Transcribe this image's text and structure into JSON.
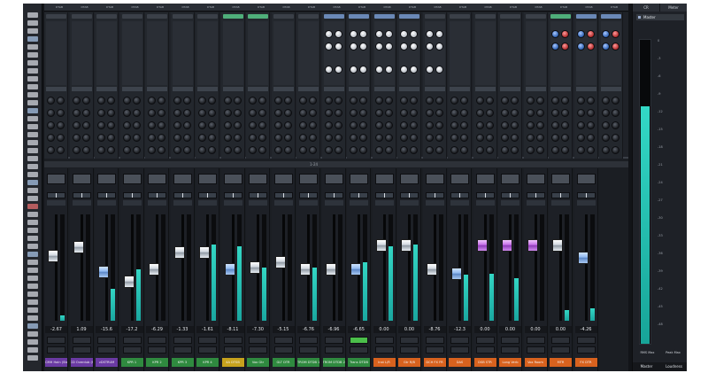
{
  "app": {
    "title": "MIXER"
  },
  "colors": {
    "accent_teal": "#33d6c4",
    "mute_green": "#4bbf4a",
    "strip_bg": "#1d2026",
    "bg": "#121418"
  },
  "top_channel_names": [
    "DTAB",
    "DTAB",
    "DTAB",
    "DTAB",
    "DTAB",
    "DTAB",
    "DTAB",
    "DTAB",
    "DTAB",
    "DTAB",
    "DTAB",
    "DTAB",
    "DTAB",
    "DTAB",
    "DTAB",
    "DTAB",
    "DTAB",
    "DTAB",
    "DTAB",
    "DTAB",
    "DTAB",
    "DTAB",
    "DTAB"
  ],
  "overview_label": "1-24",
  "channels": [
    {
      "value": "-2.67",
      "fader_level": 0.62,
      "meter_level": 0.05,
      "fader_style": "w",
      "name": "CMH Hain (Stereo 1)",
      "name_color": "#6a3aa3",
      "mute_on": false
    },
    {
      "value": "1.09",
      "fader_level": 0.72,
      "meter_level": 0.0,
      "fader_style": "w",
      "name": "CD Overdub (Stereo)",
      "name_color": "#6a3aa3",
      "mute_on": false
    },
    {
      "value": "-15.6",
      "fader_level": 0.45,
      "meter_level": 0.3,
      "fader_style": "b",
      "name": "vDSTRUM",
      "name_color": "#6a3aa3",
      "mute_on": false
    },
    {
      "value": "-17.2",
      "fader_level": 0.35,
      "meter_level": 0.48,
      "fader_style": "w",
      "name": "KPR 1",
      "name_color": "#2f8a3f",
      "mute_on": false
    },
    {
      "value": "-6.29",
      "fader_level": 0.48,
      "meter_level": 0.0,
      "fader_style": "w",
      "name": "KPR 2",
      "name_color": "#2f8a3f",
      "mute_on": false
    },
    {
      "value": "-1.33",
      "fader_level": 0.66,
      "meter_level": 0.0,
      "fader_style": "w",
      "name": "KPR 3",
      "name_color": "#2f8a3f",
      "mute_on": false
    },
    {
      "value": "-1.61",
      "fader_level": 0.66,
      "meter_level": 0.72,
      "fader_style": "w",
      "name": "KPR 4",
      "name_color": "#2f8a3f",
      "mute_on": false
    },
    {
      "value": "-8.11",
      "fader_level": 0.48,
      "meter_level": 0.7,
      "fader_style": "b",
      "name": "4A DTSB",
      "name_color": "#c7a21d",
      "mute_on": false
    },
    {
      "value": "-7.30",
      "fader_level": 0.5,
      "meter_level": 0.5,
      "fader_style": "w",
      "name": "Vox Gtr",
      "name_color": "#2f8a3f",
      "mute_on": false
    },
    {
      "value": "-5.15",
      "fader_level": 0.56,
      "meter_level": 0.0,
      "fader_style": "w",
      "name": "GLT DTR",
      "name_color": "#2f8a3f",
      "mute_on": false
    },
    {
      "value": "-6.76",
      "fader_level": 0.48,
      "meter_level": 0.5,
      "fader_style": "w",
      "name": "TROM DTDB 1",
      "name_color": "#2f8a3f",
      "mute_on": false
    },
    {
      "value": "-6.96",
      "fader_level": 0.48,
      "meter_level": 0.0,
      "fader_style": "w",
      "name": "TROM DTDB 2",
      "name_color": "#2f8a3f",
      "mute_on": false
    },
    {
      "value": "-6.65",
      "fader_level": 0.48,
      "meter_level": 0.55,
      "fader_style": "b",
      "name": "Trans DTDB",
      "name_color": "#2f8a3f",
      "mute_on": true
    },
    {
      "value": "0.00",
      "fader_level": 0.74,
      "meter_level": 0.7,
      "fader_style": "w",
      "name": "Inst L/R",
      "name_color": "#d8621e",
      "mute_on": false
    },
    {
      "value": "0.00",
      "fader_level": 0.74,
      "meter_level": 0.72,
      "fader_style": "w",
      "name": "Gtr R/B",
      "name_color": "#d8621e",
      "mute_on": false
    },
    {
      "value": "-8.76",
      "fader_level": 0.48,
      "meter_level": 0.0,
      "fader_style": "w",
      "name": "DCH FX FR",
      "name_color": "#d8621e",
      "mute_on": false
    },
    {
      "value": "-12.3",
      "fader_level": 0.43,
      "meter_level": 0.43,
      "fader_style": "b",
      "name": "DAS",
      "name_color": "#d8621e",
      "mute_on": false
    },
    {
      "value": "0.00",
      "fader_level": 0.74,
      "meter_level": 0.44,
      "fader_style": "p",
      "name": "DSB STR",
      "name_color": "#d8621e",
      "mute_on": false
    },
    {
      "value": "0.00",
      "fader_level": 0.74,
      "meter_level": 0.4,
      "fader_style": "p",
      "name": "Long Verb",
      "name_color": "#d8621e",
      "mute_on": false
    },
    {
      "value": "0.00",
      "fader_level": 0.74,
      "meter_level": 0.0,
      "fader_style": "p",
      "name": "Vox Room",
      "name_color": "#d8621e",
      "mute_on": false
    },
    {
      "value": "0.00",
      "fader_level": 0.74,
      "meter_level": 0.1,
      "fader_style": "w",
      "name": "MTR",
      "name_color": "#d8621e",
      "mute_on": false
    },
    {
      "value": "-4.26",
      "fader_level": 0.6,
      "meter_level": 0.12,
      "fader_style": "b",
      "name": "FX DTR",
      "name_color": "#d8621e",
      "mute_on": false
    }
  ],
  "master": {
    "tabs": [
      "CR",
      "Meter"
    ],
    "header": "Master",
    "meter_level": 0.78,
    "scale": [
      "0",
      "-3",
      "-6",
      "-9",
      "-12",
      "-15",
      "-18",
      "-21",
      "-24",
      "-27",
      "-30",
      "-33",
      "-36",
      "-39",
      "-42",
      "-45",
      "-48"
    ],
    "readouts": [
      "RMS Max",
      "Peak Max"
    ],
    "values": [
      "-8.6",
      "1.4"
    ],
    "footer": [
      "Master",
      "Loudness"
    ]
  }
}
